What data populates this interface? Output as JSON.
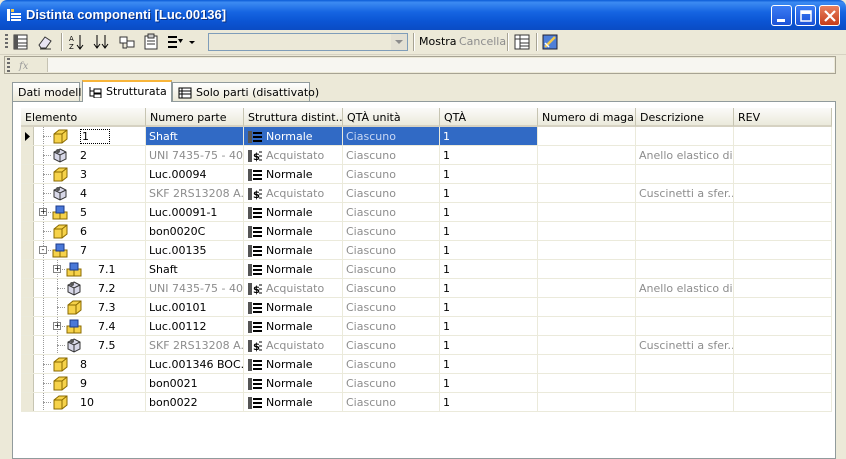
{
  "window": {
    "title": "Distinta componenti [Luc.00136]"
  },
  "toolbar": {
    "combo_value": "",
    "mostra": "Mostra",
    "cancella": "Cancella"
  },
  "tabs": [
    {
      "label": "Dati modello",
      "active": false
    },
    {
      "label": "Strutturata",
      "active": true
    },
    {
      "label": "Solo parti (disattivato)",
      "active": false
    }
  ],
  "columns": [
    "Elemento",
    "Numero parte",
    "Struttura distint...",
    "QTÀ unità",
    "QTÀ",
    "Numero di maga...",
    "Descrizione",
    "REV"
  ],
  "rows": [
    {
      "level": 0,
      "num": "1",
      "part": "Shaft",
      "struct": "Normale",
      "unit": "Ciascuno",
      "qty": "1",
      "store": "",
      "desc": "",
      "rev": "",
      "icon": "part",
      "expander": "",
      "selected": true,
      "muted": false
    },
    {
      "level": 0,
      "num": "2",
      "part": "UNI 7435-75 - 40",
      "struct": "Acquistato",
      "unit": "Ciascuno",
      "qty": "1",
      "store": "",
      "desc": "Anello elastico di...",
      "rev": "",
      "icon": "purchased",
      "expander": "",
      "selected": false,
      "muted": true
    },
    {
      "level": 0,
      "num": "3",
      "part": "Luc.00094",
      "struct": "Normale",
      "unit": "Ciascuno",
      "qty": "1",
      "store": "",
      "desc": "",
      "rev": "",
      "icon": "part",
      "expander": "",
      "selected": false,
      "muted": false
    },
    {
      "level": 0,
      "num": "4",
      "part": "SKF 2RS13208 A...",
      "struct": "Acquistato",
      "unit": "Ciascuno",
      "qty": "1",
      "store": "",
      "desc": "Cuscinetti a sfer...",
      "rev": "",
      "icon": "purchased",
      "expander": "",
      "selected": false,
      "muted": true
    },
    {
      "level": 0,
      "num": "5",
      "part": "Luc.00091-1",
      "struct": "Normale",
      "unit": "Ciascuno",
      "qty": "1",
      "store": "",
      "desc": "",
      "rev": "",
      "icon": "assembly",
      "expander": "+",
      "selected": false,
      "muted": false
    },
    {
      "level": 0,
      "num": "6",
      "part": "bon0020C",
      "struct": "Normale",
      "unit": "Ciascuno",
      "qty": "1",
      "store": "",
      "desc": "",
      "rev": "",
      "icon": "part",
      "expander": "",
      "selected": false,
      "muted": false
    },
    {
      "level": 0,
      "num": "7",
      "part": "Luc.00135",
      "struct": "Normale",
      "unit": "Ciascuno",
      "qty": "1",
      "store": "",
      "desc": "",
      "rev": "",
      "icon": "assembly",
      "expander": "-",
      "selected": false,
      "muted": false
    },
    {
      "level": 1,
      "num": "7.1",
      "part": "Shaft",
      "struct": "Normale",
      "unit": "Ciascuno",
      "qty": "1",
      "store": "",
      "desc": "",
      "rev": "",
      "icon": "assembly",
      "expander": "+",
      "selected": false,
      "muted": false
    },
    {
      "level": 1,
      "num": "7.2",
      "part": "UNI 7435-75 - 40",
      "struct": "Acquistato",
      "unit": "Ciascuno",
      "qty": "1",
      "store": "",
      "desc": "Anello elastico di...",
      "rev": "",
      "icon": "purchased",
      "expander": "",
      "selected": false,
      "muted": true
    },
    {
      "level": 1,
      "num": "7.3",
      "part": "Luc.00101",
      "struct": "Normale",
      "unit": "Ciascuno",
      "qty": "1",
      "store": "",
      "desc": "",
      "rev": "",
      "icon": "part",
      "expander": "",
      "selected": false,
      "muted": false
    },
    {
      "level": 1,
      "num": "7.4",
      "part": "Luc.00112",
      "struct": "Normale",
      "unit": "Ciascuno",
      "qty": "1",
      "store": "",
      "desc": "",
      "rev": "",
      "icon": "assembly",
      "expander": "+",
      "selected": false,
      "muted": false
    },
    {
      "level": 1,
      "num": "7.5",
      "part": "SKF 2RS13208 A...",
      "struct": "Acquistato",
      "unit": "Ciascuno",
      "qty": "1",
      "store": "",
      "desc": "Cuscinetti a sfer...",
      "rev": "",
      "icon": "purchased",
      "expander": "",
      "selected": false,
      "muted": true
    },
    {
      "level": 0,
      "num": "8",
      "part": "Luc.001346 BOC...",
      "struct": "Normale",
      "unit": "Ciascuno",
      "qty": "1",
      "store": "",
      "desc": "",
      "rev": "",
      "icon": "part",
      "expander": "",
      "selected": false,
      "muted": false
    },
    {
      "level": 0,
      "num": "9",
      "part": "bon0021",
      "struct": "Normale",
      "unit": "Ciascuno",
      "qty": "1",
      "store": "",
      "desc": "",
      "rev": "",
      "icon": "part",
      "expander": "",
      "selected": false,
      "muted": false
    },
    {
      "level": 0,
      "num": "10",
      "part": "bon0022",
      "struct": "Normale",
      "unit": "Ciascuno",
      "qty": "1",
      "store": "",
      "desc": "",
      "rev": "",
      "icon": "part",
      "expander": "",
      "selected": false,
      "muted": false
    }
  ],
  "colors": {
    "selection": "#316ac5",
    "titlebar": "#0a5bd6",
    "muted_text": "#8d8d8d"
  }
}
